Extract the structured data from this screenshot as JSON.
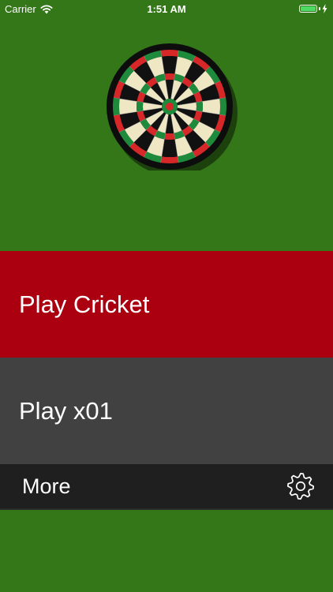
{
  "status_bar": {
    "carrier": "Carrier",
    "time": "1:51 AM",
    "battery_level": 1.0
  },
  "menu": {
    "cricket_label": "Play Cricket",
    "x01_label": "Play x01",
    "more_label": "More"
  },
  "icons": {
    "wifi": "wifi-icon",
    "battery": "battery-icon",
    "charging": "charging-bolt-icon",
    "settings": "gear-icon",
    "logo": "dartboard-logo"
  },
  "colors": {
    "background": "#347719",
    "cricket_row": "#ab0010",
    "x01_row": "#414141",
    "more_row": "#1f1f1f",
    "board_black": "#111111",
    "board_cream": "#efe7c4",
    "board_red": "#d62828",
    "board_green": "#1e8a3c"
  }
}
